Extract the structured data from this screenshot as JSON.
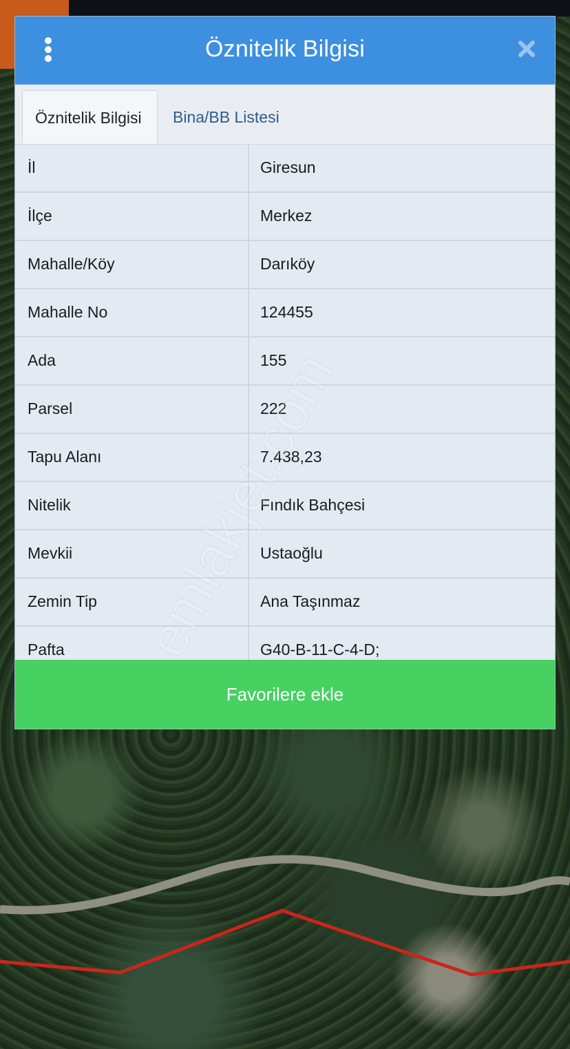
{
  "dialog": {
    "title": "Öznitelik Bilgisi",
    "tabs": [
      {
        "label": "Öznitelik Bilgisi",
        "active": true
      },
      {
        "label": "Bina/BB Listesi",
        "active": false
      }
    ],
    "rows": [
      {
        "key": "İl",
        "value": "Giresun"
      },
      {
        "key": "İlçe",
        "value": "Merkez"
      },
      {
        "key": "Mahalle/Köy",
        "value": "Darıköy"
      },
      {
        "key": "Mahalle No",
        "value": "124455"
      },
      {
        "key": "Ada",
        "value": "155"
      },
      {
        "key": "Parsel",
        "value": "222"
      },
      {
        "key": "Tapu Alanı",
        "value": "7.438,23"
      },
      {
        "key": "Nitelik",
        "value": "Fındık Bahçesi"
      },
      {
        "key": "Mevkii",
        "value": "Ustaoğlu"
      },
      {
        "key": "Zemin Tip",
        "value": "Ana Taşınmaz"
      },
      {
        "key": "Pafta",
        "value": "G40-B-11-C-4-D;"
      }
    ],
    "favorite_button": "Favorilere ekle"
  },
  "watermark": "emlakjet.com",
  "icons": {
    "menu": "kebab-menu-icon",
    "close": "close-icon"
  },
  "colors": {
    "header": "#3d8fe0",
    "favorite": "#46d160",
    "tab_link": "#2d5b8c"
  }
}
